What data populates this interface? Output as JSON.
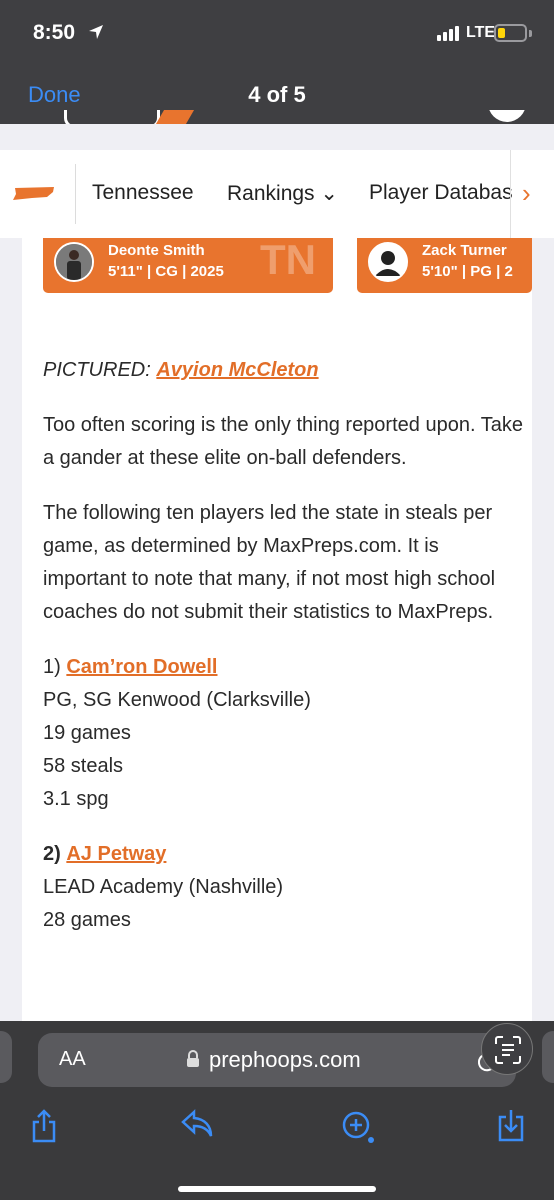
{
  "status_bar": {
    "time": "8:50",
    "network": "LTE"
  },
  "viewer": {
    "done_label": "Done",
    "page_counter": "4 of 5"
  },
  "site_nav": {
    "items": [
      {
        "label": "Tennessee"
      },
      {
        "label": "Rankings ⌄"
      },
      {
        "label": "Player Databas"
      }
    ],
    "next_arrow": "›"
  },
  "player_cards": [
    {
      "name": "Deonte Smith",
      "meta": "5'11\" | CG | 2025",
      "state": "TN"
    },
    {
      "name": "Zack Turner",
      "meta": "5'10\" | PG | 2"
    }
  ],
  "article": {
    "pictured_label": "PICTURED:",
    "pictured_name": "Avyion McCleton",
    "para1": "Too often scoring is the only thing reported upon. Take a gander at these elite on-ball defenders.",
    "para2": "The following ten players led the state in steals per game, as determined by MaxPreps.com. It is important to note that many, if not most high school coaches do not submit their statistics to MaxPreps.",
    "entries": [
      {
        "rank": "1)",
        "name": "Cam’ron Dowell",
        "school": "PG, SG Kenwood (Clarksville)",
        "games": "19 games",
        "steals": "58 steals",
        "spg": "3.1 spg"
      },
      {
        "rank": "2)",
        "name": "AJ Petway",
        "school": "LEAD Academy (Nashville)",
        "games": "28 games"
      }
    ]
  },
  "address_bar": {
    "aa_label": "AA",
    "url": "prephoops.com"
  },
  "colors": {
    "accent": "#e8742e",
    "ios_blue": "#3b8cf5"
  },
  "icons": [
    "location-arrow-icon",
    "signal-icon",
    "battery-icon",
    "lock-icon",
    "reload-icon",
    "text-scan-icon",
    "share-icon",
    "reply-icon",
    "markup-icon",
    "save-icon"
  ]
}
